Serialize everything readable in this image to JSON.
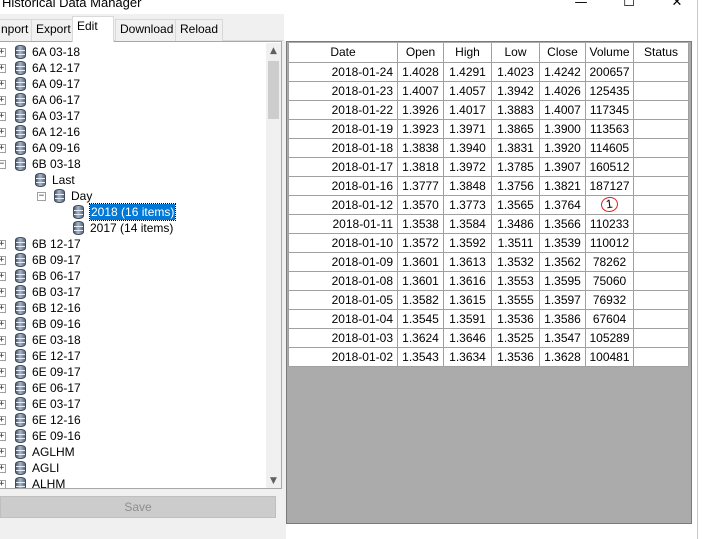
{
  "window": {
    "title": "Historical Data Manager",
    "min_glyph": "—",
    "max_glyph": "☐",
    "close_glyph": "✕"
  },
  "tabs": [
    {
      "label": "nport"
    },
    {
      "label": "Export"
    },
    {
      "label": "Edit",
      "active": true
    },
    {
      "label": "Download"
    },
    {
      "label": "Reload"
    }
  ],
  "tree": {
    "items": [
      {
        "label": "6A 03-18",
        "level": 0,
        "expander": "+"
      },
      {
        "label": "6A 12-17",
        "level": 0,
        "expander": "+"
      },
      {
        "label": "6A 09-17",
        "level": 0,
        "expander": "+"
      },
      {
        "label": "6A 06-17",
        "level": 0,
        "expander": "+"
      },
      {
        "label": "6A 03-17",
        "level": 0,
        "expander": "+"
      },
      {
        "label": "6A 12-16",
        "level": 0,
        "expander": "+"
      },
      {
        "label": "6A 09-16",
        "level": 0,
        "expander": "+"
      },
      {
        "label": "6B 03-18",
        "level": 0,
        "expander": "−"
      },
      {
        "label": "Last",
        "level": 1,
        "expander": ""
      },
      {
        "label": "Day",
        "level": 2,
        "expander": "−"
      },
      {
        "label": "2018 (16 items)",
        "level": 3,
        "expander": "",
        "selected": true
      },
      {
        "label": "2017 (14 items)",
        "level": 3,
        "expander": ""
      },
      {
        "label": "6B 12-17",
        "level": 0,
        "expander": "+"
      },
      {
        "label": "6B 09-17",
        "level": 0,
        "expander": "+"
      },
      {
        "label": "6B 06-17",
        "level": 0,
        "expander": "+"
      },
      {
        "label": "6B 03-17",
        "level": 0,
        "expander": "+"
      },
      {
        "label": "6B 12-16",
        "level": 0,
        "expander": "+"
      },
      {
        "label": "6B 09-16",
        "level": 0,
        "expander": "+"
      },
      {
        "label": "6E 03-18",
        "level": 0,
        "expander": "+"
      },
      {
        "label": "6E 12-17",
        "level": 0,
        "expander": "+"
      },
      {
        "label": "6E 09-17",
        "level": 0,
        "expander": "+"
      },
      {
        "label": "6E 06-17",
        "level": 0,
        "expander": "+"
      },
      {
        "label": "6E 03-17",
        "level": 0,
        "expander": "+"
      },
      {
        "label": "6E 12-16",
        "level": 0,
        "expander": "+"
      },
      {
        "label": "6E 09-16",
        "level": 0,
        "expander": "+"
      },
      {
        "label": "AGLHM",
        "level": 0,
        "expander": "+"
      },
      {
        "label": "AGLI",
        "level": 0,
        "expander": "+"
      },
      {
        "label": "ALHM",
        "level": 0,
        "expander": "+"
      }
    ],
    "scroll_up_glyph": "▲",
    "scroll_down_glyph": "▼"
  },
  "save_button": {
    "label": "Save",
    "enabled": false
  },
  "grid": {
    "columns": [
      "Date",
      "Open",
      "High",
      "Low",
      "Close",
      "Volume",
      "Status"
    ],
    "rows": [
      [
        "2018-01-24",
        "1.4028",
        "1.4291",
        "1.4023",
        "1.4242",
        "200657",
        ""
      ],
      [
        "2018-01-23",
        "1.4007",
        "1.4057",
        "1.3942",
        "1.4026",
        "125435",
        ""
      ],
      [
        "2018-01-22",
        "1.3926",
        "1.4017",
        "1.3883",
        "1.4007",
        "117345",
        ""
      ],
      [
        "2018-01-19",
        "1.3923",
        "1.3971",
        "1.3865",
        "1.3900",
        "113563",
        ""
      ],
      [
        "2018-01-18",
        "1.3838",
        "1.3940",
        "1.3831",
        "1.3920",
        "114605",
        ""
      ],
      [
        "2018-01-17",
        "1.3818",
        "1.3972",
        "1.3785",
        "1.3907",
        "160512",
        ""
      ],
      [
        "2018-01-16",
        "1.3777",
        "1.3848",
        "1.3756",
        "1.3821",
        "187127",
        ""
      ],
      [
        "2018-01-12",
        "1.3570",
        "1.3773",
        "1.3565",
        "1.3764",
        "1",
        ""
      ],
      [
        "2018-01-11",
        "1.3538",
        "1.3584",
        "1.3486",
        "1.3566",
        "110233",
        ""
      ],
      [
        "2018-01-10",
        "1.3572",
        "1.3592",
        "1.3511",
        "1.3539",
        "110012",
        ""
      ],
      [
        "2018-01-09",
        "1.3601",
        "1.3613",
        "1.3532",
        "1.3562",
        "78262",
        ""
      ],
      [
        "2018-01-08",
        "1.3601",
        "1.3616",
        "1.3553",
        "1.3595",
        "75060",
        ""
      ],
      [
        "2018-01-05",
        "1.3582",
        "1.3615",
        "1.3555",
        "1.3597",
        "76932",
        ""
      ],
      [
        "2018-01-04",
        "1.3545",
        "1.3591",
        "1.3536",
        "1.3586",
        "67604",
        ""
      ],
      [
        "2018-01-03",
        "1.3624",
        "1.3646",
        "1.3525",
        "1.3547",
        "105289",
        ""
      ],
      [
        "2018-01-02",
        "1.3543",
        "1.3634",
        "1.3536",
        "1.3628",
        "100481",
        ""
      ]
    ],
    "highlighted_cell": {
      "row": 7,
      "column": "Volume",
      "annotation": "red-circle"
    }
  }
}
